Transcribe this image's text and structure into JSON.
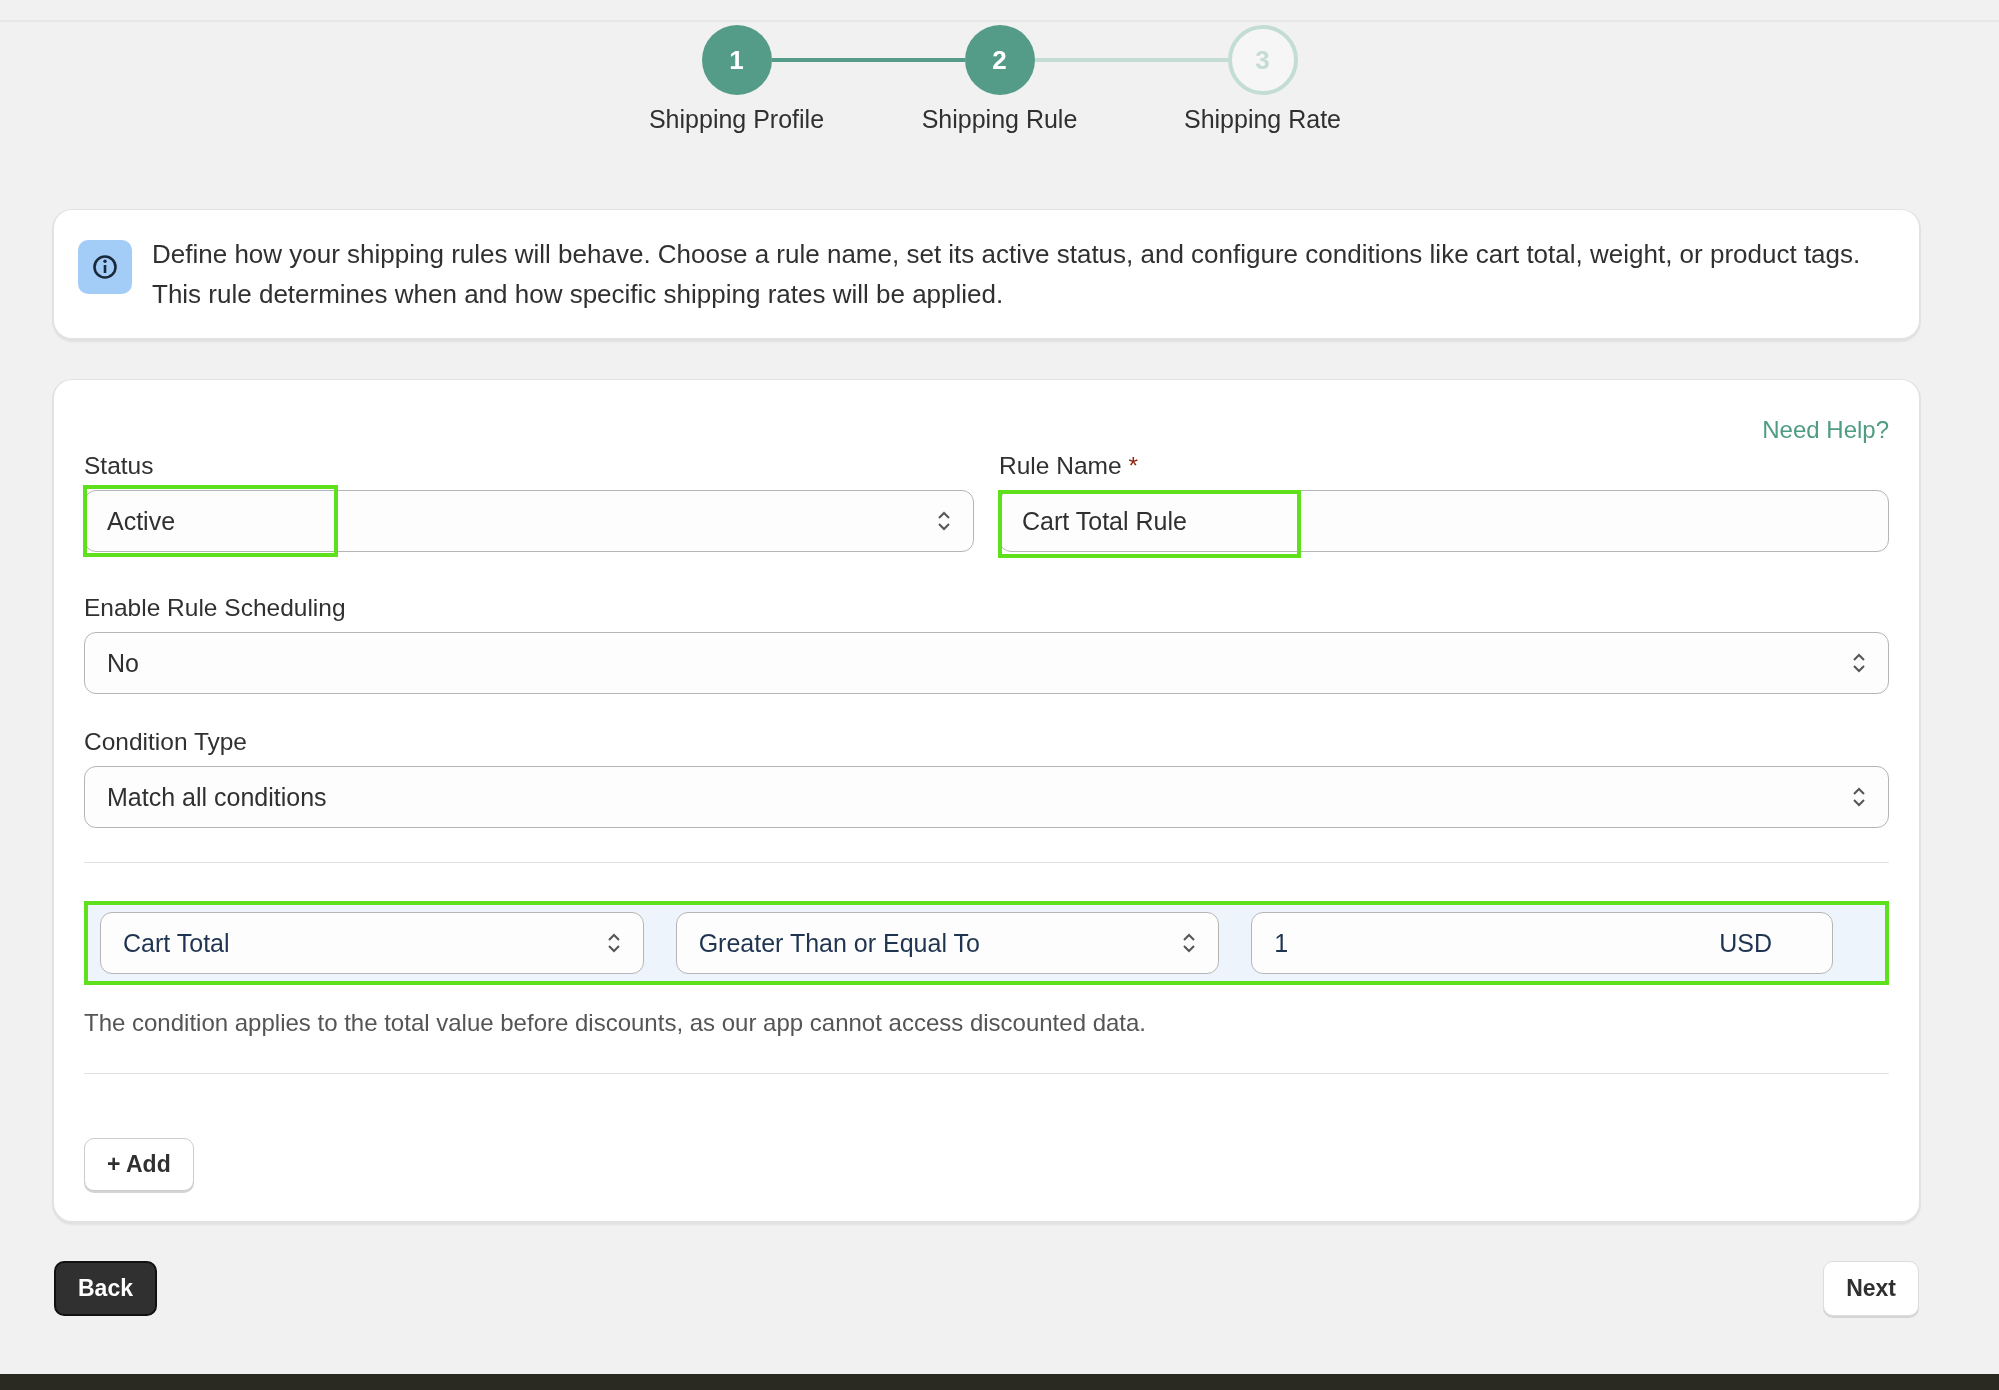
{
  "stepper": {
    "steps": [
      {
        "number": "1",
        "label": "Shipping Profile",
        "done": true
      },
      {
        "number": "2",
        "label": "Shipping Rule",
        "done": true
      },
      {
        "number": "3",
        "label": "Shipping Rate",
        "done": false
      }
    ]
  },
  "info": {
    "text": "Define how your shipping rules will behave. Choose a rule name, set its active status, and configure conditions like cart total, weight, or product tags. This rule determines when and how specific shipping rates will be applied."
  },
  "form": {
    "help_link": "Need Help?",
    "status": {
      "label": "Status",
      "value": "Active",
      "highlighted": true
    },
    "rule_name": {
      "label": "Rule Name",
      "required_mark": "*",
      "value": "Cart Total Rule",
      "highlighted": true
    },
    "scheduling": {
      "label": "Enable Rule Scheduling",
      "value": "No"
    },
    "condition_type": {
      "label": "Condition Type",
      "value": "Match all conditions"
    },
    "conditions": [
      {
        "field": "Cart Total",
        "operator": "Greater Than or Equal To",
        "value": "1",
        "unit": "USD",
        "highlighted": true
      }
    ],
    "note": "The condition applies to the total value before discounts, as our app cannot access discounted data.",
    "add_button": "+ Add"
  },
  "footer": {
    "back": "Back",
    "next": "Next"
  }
}
